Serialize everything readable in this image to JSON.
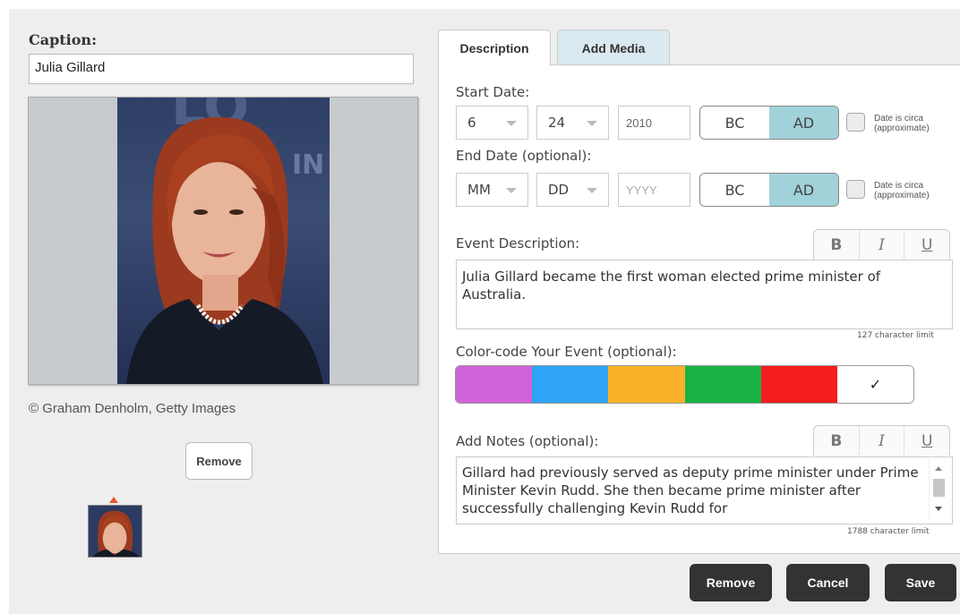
{
  "caption": {
    "label": "Caption:",
    "value": "Julia Gillard"
  },
  "image": {
    "credit": "© Graham Denholm, Getty Images",
    "remove_label": "Remove"
  },
  "tabs": [
    {
      "label": "Description",
      "active": true
    },
    {
      "label": "Add Media",
      "active": false
    }
  ],
  "start_date": {
    "label": "Start Date:",
    "month": "6",
    "day": "24",
    "year": "2010",
    "era_bc": "BC",
    "era_ad": "AD",
    "selected_era": "AD",
    "circa_line1": "Date is circa",
    "circa_line2": "(approximate)"
  },
  "end_date": {
    "label": "End Date (optional):",
    "month_placeholder": "MM",
    "day_placeholder": "DD",
    "year_placeholder": "YYYY",
    "era_bc": "BC",
    "era_ad": "AD",
    "selected_era": "AD",
    "circa_line1": "Date is circa",
    "circa_line2": "(approximate)"
  },
  "event_description": {
    "label": "Event Description:",
    "text": "Julia Gillard became the first woman elected prime minister of Australia.",
    "limit": "127 character limit"
  },
  "format_buttons": {
    "bold": "B",
    "italic": "I",
    "underline": "U"
  },
  "color_code": {
    "label": "Color-code Your Event (optional):",
    "swatches": [
      "#cf63d9",
      "#2fa3f5",
      "#fbb22a",
      "#19b245",
      "#f51d1d",
      "#ffffff"
    ],
    "selected_mark": "✓"
  },
  "notes": {
    "label": "Add Notes (optional):",
    "text": "Gillard had previously served as deputy prime minister under Prime Minister Kevin Rudd. She then became prime minister after successfully challenging Kevin Rudd for",
    "limit": "1788 character limit"
  },
  "actions": {
    "remove": "Remove",
    "cancel": "Cancel",
    "save": "Save"
  }
}
